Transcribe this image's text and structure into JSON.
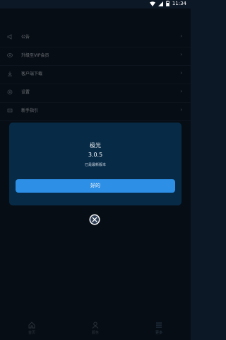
{
  "status": {
    "time": "11:34"
  },
  "menu": [
    {
      "label": "公告",
      "icon": "megaphone-icon"
    },
    {
      "label": "升级至VIP会员",
      "icon": "vip-icon"
    },
    {
      "label": "客户端下载",
      "icon": "download-icon"
    },
    {
      "label": "设置",
      "icon": "gear-icon"
    },
    {
      "label": "新手指引",
      "icon": "guide-icon"
    }
  ],
  "dialog": {
    "title": "极光",
    "version": "3.0.5",
    "subtitle": "已是最新版本",
    "ok_label": "好的"
  },
  "nav": [
    {
      "label": "首页",
      "icon": "home-icon"
    },
    {
      "label": "服务",
      "icon": "user-icon"
    },
    {
      "label": "更多",
      "icon": "menu-icon"
    }
  ],
  "colors": {
    "background": "#0d1826",
    "dialog": "#072a47",
    "accent": "#2d8fe6"
  }
}
